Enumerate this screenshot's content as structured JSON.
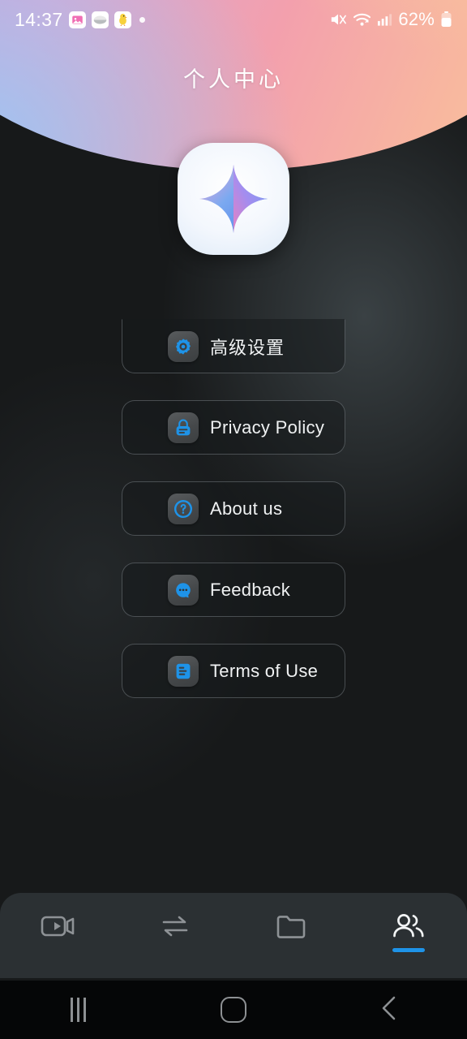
{
  "status_bar": {
    "time": "14:37",
    "notification_icons": [
      "photo-icon",
      "eye-oval-icon",
      "chick-emoji-icon"
    ],
    "notification_overflow_dot": "•",
    "mute_icon": "volume-mute-icon",
    "wifi_icon": "wifi-icon",
    "signal_icon": "cellular-signal-icon",
    "battery_percent": "62%",
    "battery_icon": "battery-icon"
  },
  "header": {
    "title": "个人中心",
    "gradient_start": "#b7a6e2",
    "gradient_mid": "#f3a0ad",
    "gradient_end": "#f9cb9e"
  },
  "logo": {
    "name": "app-logo-sparkle",
    "gradient_blue": "#5b8dee",
    "gradient_pink": "#f06fb4",
    "background": "#ffffff"
  },
  "menu": {
    "items": [
      {
        "label": "高级设置",
        "icon": "gear-icon",
        "cjk": true,
        "clipped": true
      },
      {
        "label": "Privacy Policy",
        "icon": "lock-icon",
        "cjk": false,
        "clipped": false
      },
      {
        "label": "About us",
        "icon": "question-icon",
        "cjk": false,
        "clipped": false
      },
      {
        "label": "Feedback",
        "icon": "chat-icon",
        "cjk": false,
        "clipped": false
      },
      {
        "label": "Terms of Use",
        "icon": "document-icon",
        "cjk": false,
        "clipped": false
      }
    ],
    "icon_color": "#1e93e8"
  },
  "tabbar": {
    "accent": "#1e93e8",
    "items": [
      {
        "name": "tab-video",
        "icon": "video-camera-icon",
        "active": false
      },
      {
        "name": "tab-transfer",
        "icon": "transfer-arrows-icon",
        "active": false
      },
      {
        "name": "tab-files",
        "icon": "folder-icon",
        "active": false
      },
      {
        "name": "tab-profile",
        "icon": "users-icon",
        "active": true
      }
    ]
  },
  "system_nav": {
    "recents": "recents-icon",
    "home": "home-icon",
    "back": "back-icon"
  }
}
